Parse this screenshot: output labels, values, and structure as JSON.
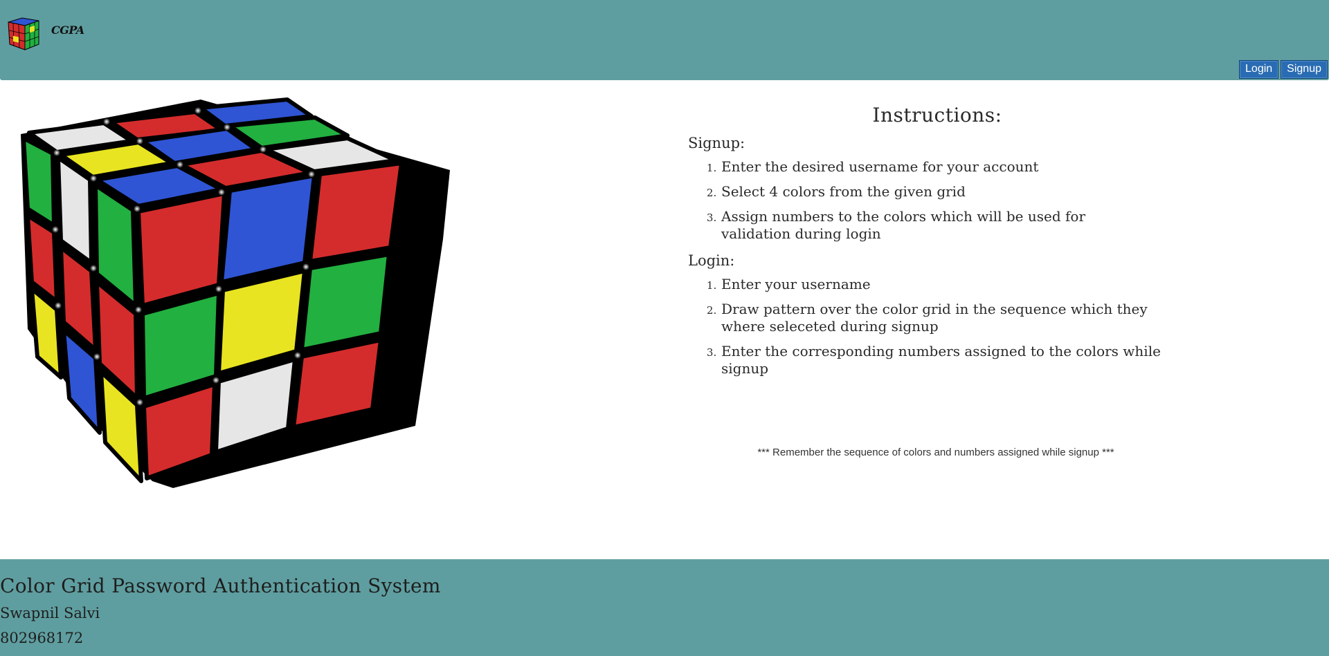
{
  "header": {
    "logo_text": "CGPA",
    "login_label": "Login",
    "signup_label": "Signup"
  },
  "instructions": {
    "heading": "Instructions:",
    "signup_title": "Signup:",
    "signup_steps": [
      "Enter the desired username for your account",
      "Select 4 colors from the given grid",
      "Assign numbers to the colors which will be used for validation during login"
    ],
    "login_title": "Login:",
    "login_steps": [
      "Enter your username",
      "Draw pattern over the color grid in the sequence which they where seleceted during signup",
      "Enter the corresponding numbers assigned to the colors while signup"
    ],
    "note": "*** Remember the sequence of colors and numbers assigned while signup ***"
  },
  "footer": {
    "title": "Color Grid Password Authentication System",
    "name": "Swapnil Salvi",
    "id": "802968172"
  },
  "colors": {
    "header_bg": "#5f9ea0",
    "button_bg": "#2a6cb3",
    "cube_red": "#d42c2c",
    "cube_blue": "#2f55d4",
    "cube_green": "#22b040",
    "cube_yellow": "#e8e421",
    "cube_white": "#e6e6e6"
  }
}
